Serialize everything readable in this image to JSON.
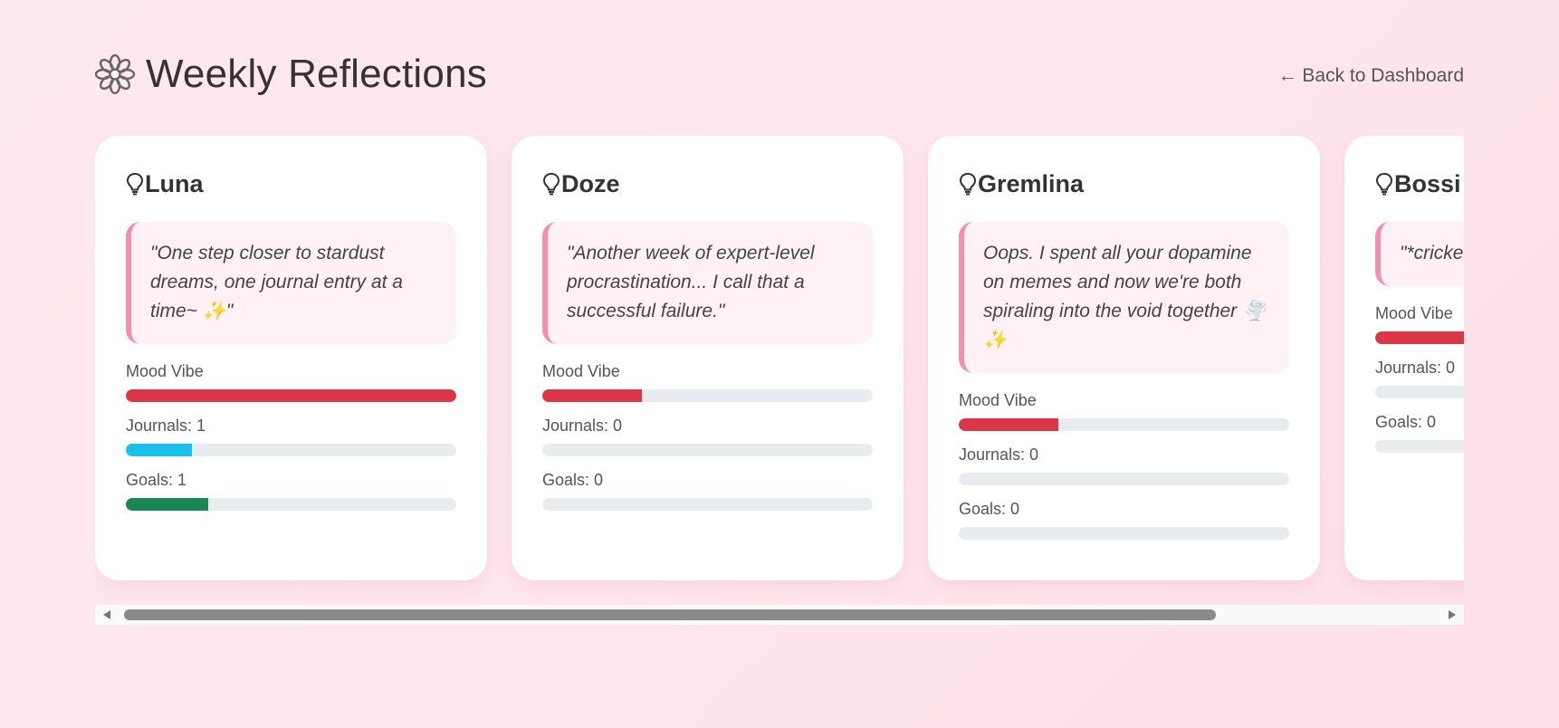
{
  "header": {
    "title": "Weekly Reflections",
    "title_icon": "flower-icon",
    "back_link": "← Back to Dashboard"
  },
  "colors": {
    "mood": "#dc3545",
    "journals": "#17c1e8",
    "goals": "#198754",
    "quote_border": "#f48fb1"
  },
  "cards": [
    {
      "name": "Luna",
      "icon": "lightbulb-icon",
      "quote": "\"One step closer to stardust dreams, one journal entry at a time~ ✨\"",
      "mood_label": "Mood Vibe",
      "mood_level": 1.0,
      "journals_label": "Journals: 1",
      "journals_level": 0.2,
      "goals_label": "Goals: 1",
      "goals_level": 0.25
    },
    {
      "name": "Doze",
      "icon": "lightbulb-icon",
      "quote": "\"Another week of expert-level procrastination... I call that a successful failure.\"",
      "mood_label": "Mood Vibe",
      "mood_level": 0.3,
      "journals_label": "Journals: 0",
      "journals_level": 0,
      "goals_label": "Goals: 0",
      "goals_level": 0
    },
    {
      "name": "Gremlina",
      "icon": "lightbulb-icon",
      "quote": "Oops. I spent all your dopamine on memes and now we're both spiraling into the void together 🌪️✨",
      "mood_label": "Mood Vibe",
      "mood_level": 0.3,
      "journals_label": "Journals: 0",
      "journals_level": 0,
      "goals_label": "Goals: 0",
      "goals_level": 0
    },
    {
      "name": "Bossi",
      "icon": "lightbulb-icon",
      "quote": "\"*cricke least yo inconsi",
      "mood_label": "Mood Vibe",
      "mood_level": 0.3,
      "journals_label": "Journals: 0",
      "journals_level": 0,
      "goals_label": "Goals: 0",
      "goals_level": 0
    }
  ],
  "scrollbar": {
    "position": 0
  }
}
